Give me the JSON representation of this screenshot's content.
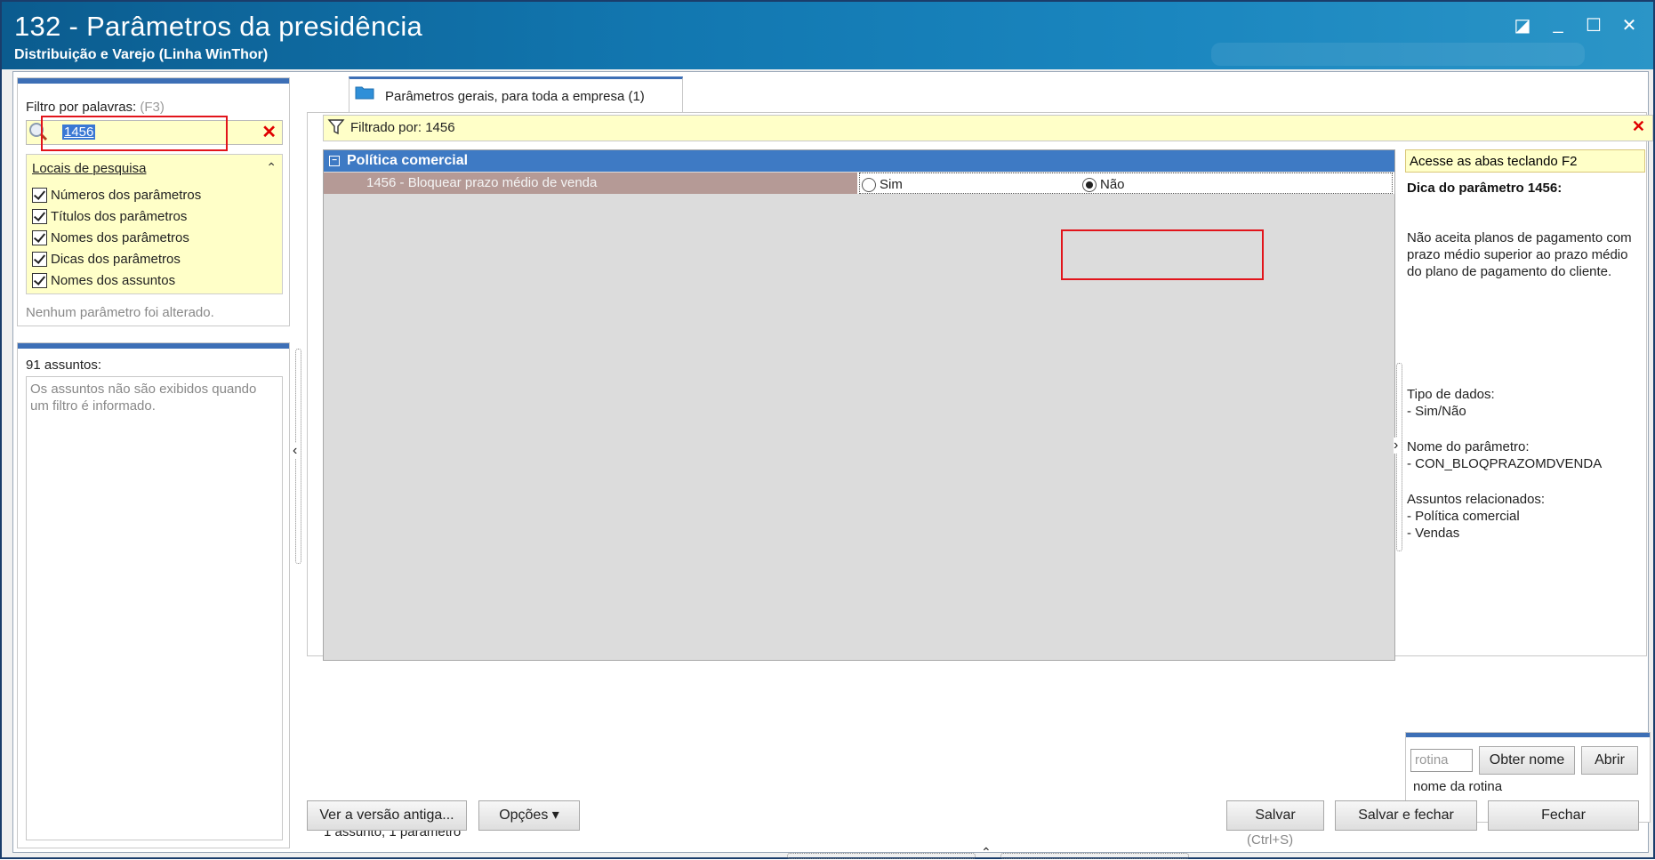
{
  "window": {
    "title": "132 - Parâmetros da presidência",
    "subtitle": "Distribuição e Varejo (Linha WinThor)"
  },
  "filter": {
    "label": "Filtro por palavras:",
    "shortcut": "(F3)",
    "value": "1456"
  },
  "locais": {
    "title": "Locais de pesquisa",
    "items": [
      {
        "label": "Números dos parâmetros",
        "checked": true
      },
      {
        "label": "Títulos dos parâmetros",
        "checked": true
      },
      {
        "label": "Nomes dos parâmetros",
        "checked": true
      },
      {
        "label": "Dicas dos parâmetros",
        "checked": true
      },
      {
        "label": "Nomes dos assuntos",
        "checked": true
      }
    ]
  },
  "status_changes": "Nenhum parâmetro foi alterado.",
  "assuntos": {
    "label": "91 assuntos:",
    "message": "Os assuntos não são exibidos quando um filtro é informado."
  },
  "tab": {
    "label": "Parâmetros gerais, para toda a empresa  (1)"
  },
  "filtered_by": "Filtrado por: 1456",
  "grid": {
    "group": "Política comercial",
    "param": {
      "name": "1456 - Bloquear prazo médio de venda",
      "opt_yes": "Sim",
      "opt_no": "Não",
      "selected": "Não"
    }
  },
  "summary": "1 assunto, 1 parâmetro",
  "hint": {
    "banner": "Acesse as abas teclando F2",
    "title": "Dica do parâmetro 1456:",
    "body": "Não aceita planos de pagamento com\nprazo médio superior ao prazo médio\ndo plano de pagamento do cliente.",
    "tipo": "Tipo de dados:\n  - Sim/Não",
    "nome": "Nome do parâmetro:\n  - CON_BLOQPRAZOMDVENDA",
    "assuntos": "Assuntos relacionados:\n  - Política comercial\n  - Vendas"
  },
  "rotina": {
    "placeholder": "rotina",
    "obter_nome": "Obter nome",
    "abrir": "Abrir",
    "label": "nome da rotina"
  },
  "buttons": {
    "ver_versao": "Ver a versão antiga...",
    "opcoes": "Opções ▾",
    "salvar": "Salvar",
    "salvar_shortcut": "(Ctrl+S)",
    "salvar_fechar": "Salvar e fechar",
    "fechar": "Fechar"
  },
  "colors": {
    "accent": "#3d6fb6",
    "highlight_box": "#e2141b",
    "yellow_panel": "#ffffc8"
  }
}
